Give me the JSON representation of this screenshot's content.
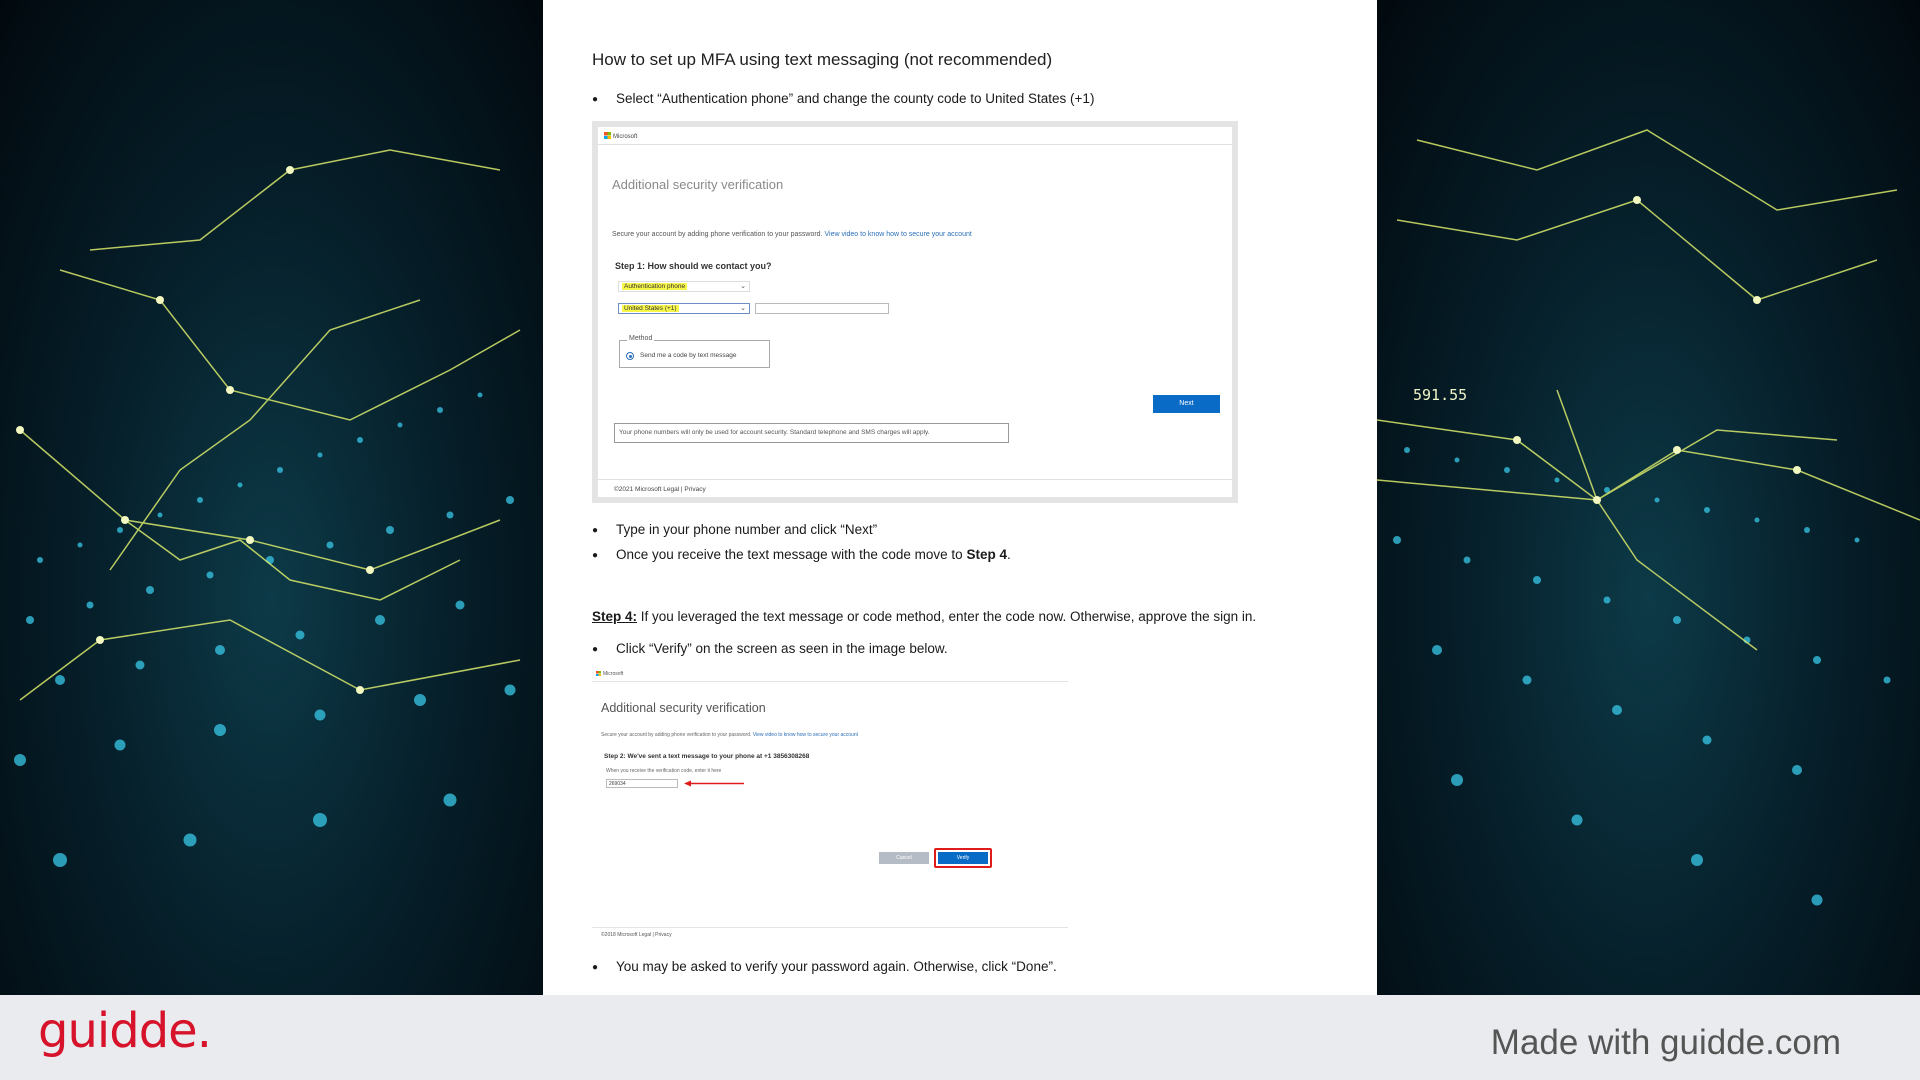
{
  "document": {
    "heading": "How to set up MFA using text messaging (not recommended)",
    "bullet_1": "Select “Authentication phone” and change the county code to United States (+1)",
    "bullet_2": "Type in your phone number and click “Next”",
    "bullet_3_prefix": "Once you receive the text message with the code move to ",
    "bullet_3_bold": "Step 4",
    "bullet_3_suffix": ".",
    "step4_label": "Step 4:",
    "step4_text": " If you leveraged the text message or code method, enter the code now. Otherwise, approve the sign in.",
    "bullet_4": "Click “Verify” on the screen as seen in the image below.",
    "bullet_5": "You may be asked to verify your password again. Otherwise, click “Done”."
  },
  "screenshot1": {
    "brand": "Microsoft",
    "title": "Additional security verification",
    "intro": "Secure your account by adding phone verification to your password. ",
    "intro_link": "View video to know how to secure your account",
    "step": "Step 1: How should we contact you?",
    "contact_select": "Authentication phone",
    "country_select": "United States (+1)",
    "phone_value": "",
    "method_legend": "Method",
    "method_option": "Send me a code by text message",
    "next_button": "Next",
    "note": "Your phone numbers will only be used for account security. Standard telephone and SMS charges will apply.",
    "footer": "©2021 Microsoft   Legal  |  Privacy"
  },
  "screenshot2": {
    "brand": "Microsoft",
    "title": "Additional security verification",
    "intro": "Secure your account by adding phone verification to your password. ",
    "intro_link": "View video to know how to secure your account",
    "step": "Step 2: We've sent a text message to your phone at +1 3856308268",
    "hint": "When you receive the verification code, enter it here",
    "code_value": "269034",
    "cancel_button": "Cancel",
    "verify_button": "Verify",
    "footer": "©2018 Microsoft   Legal  |  Privacy"
  },
  "background_right": {
    "readout": "591.55"
  },
  "bottom_bar": {
    "logo": "guidde.",
    "tagline": "Made with guidde.com"
  },
  "colors": {
    "brand_red": "#d6132b",
    "ms_blue": "#0a6bc7",
    "highlight_yellow": "#f7f74a",
    "verify_outline": "#e01b1b"
  }
}
